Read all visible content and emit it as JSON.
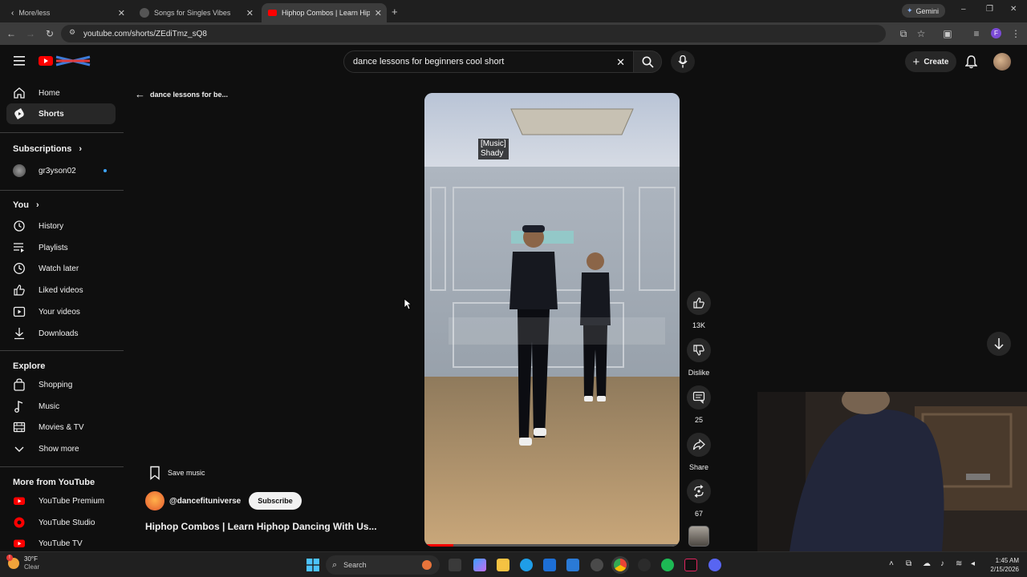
{
  "browser": {
    "tabs": [
      {
        "title": "More/less"
      },
      {
        "title": "Songs for Singles Vibes"
      },
      {
        "title": "Hiphop Combos | Learn Hiphop"
      }
    ],
    "gemini_label": "Gemini",
    "url": "youtube.com/shorts/ZEdiTmz_sQ8"
  },
  "header": {
    "search_value": "dance lessons for beginners cool short",
    "create_label": "Create"
  },
  "sidebar": {
    "main": [
      {
        "label": "Home",
        "icon": "home-icon"
      },
      {
        "label": "Shorts",
        "icon": "shorts-icon"
      }
    ],
    "subscriptions_title": "Subscriptions",
    "subscriptions": [
      {
        "label": "gr3yson02"
      }
    ],
    "you_title": "You",
    "you_items": [
      {
        "label": "History"
      },
      {
        "label": "Playlists"
      },
      {
        "label": "Watch later"
      },
      {
        "label": "Liked videos"
      },
      {
        "label": "Your videos"
      },
      {
        "label": "Downloads"
      }
    ],
    "explore_title": "Explore",
    "explore_items": [
      {
        "label": "Shopping"
      },
      {
        "label": "Music"
      },
      {
        "label": "Movies & TV"
      },
      {
        "label": "Show more"
      }
    ],
    "more_title": "More from YouTube",
    "more_items": [
      {
        "label": "YouTube Premium"
      },
      {
        "label": "YouTube Studio"
      },
      {
        "label": "YouTube TV"
      }
    ]
  },
  "main": {
    "back_label": "dance lessons for be...",
    "caption_line1": "[Music]",
    "caption_line2": "Shady",
    "actions": {
      "like_count": "13K",
      "dislike_label": "Dislike",
      "comment_count": "25",
      "share_label": "Share",
      "remix_count": "67"
    },
    "save_music_label": "Save music",
    "channel": "@dancefituniverse",
    "subscribe_label": "Subscribe",
    "title": "Hiphop Combos | Learn Hiphop Dancing With Us..."
  },
  "taskbar": {
    "weather_temp": "30°F",
    "weather_desc": "Clear",
    "search_label": "Search",
    "time": "1:45 AM",
    "date": "2/15/2026"
  },
  "colors": {
    "yt_red": "#ff0000",
    "accent_blue": "#8ab4f8"
  }
}
